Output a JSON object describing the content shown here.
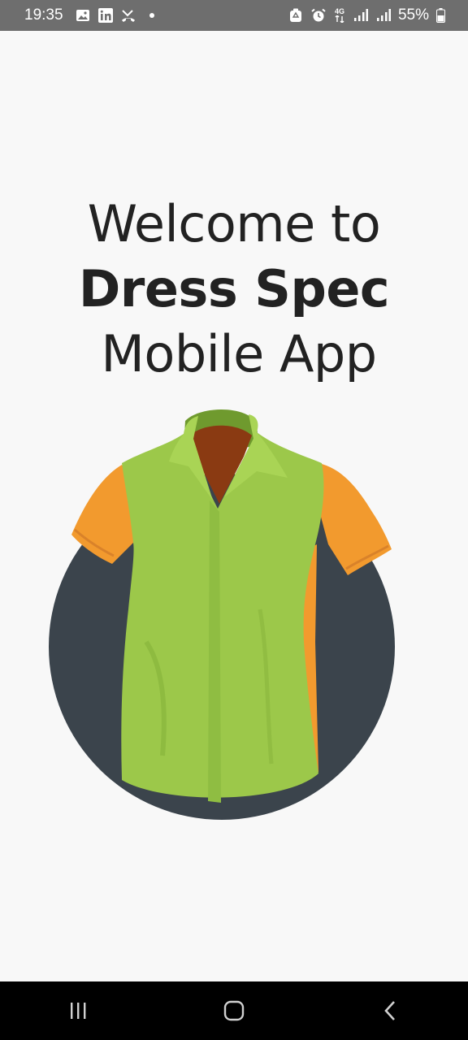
{
  "status_bar": {
    "time": "19:35",
    "left_icons": [
      "gallery-icon",
      "linkedin-icon",
      "missed-call-icon",
      "notification-dot-icon"
    ],
    "right_icons": [
      "recycle-icon",
      "alarm-icon",
      "4g-data-icon",
      "signal-icon",
      "signal-icon-2",
      "battery-icon"
    ],
    "network_label": "4G",
    "battery": "55%"
  },
  "welcome": {
    "line1": "Welcome to",
    "brand": "Dress Spec",
    "line3": "Mobile App"
  },
  "illustration": {
    "icon": "shirt-illustration",
    "colors": {
      "circle": "#3b444c",
      "shirt_body": "#9cc84a",
      "sleeves": "#f29a2e",
      "collar_inner": "#8a3a12"
    }
  },
  "nav_bar": {
    "buttons": [
      "recent-apps-icon",
      "home-icon",
      "back-icon"
    ]
  }
}
